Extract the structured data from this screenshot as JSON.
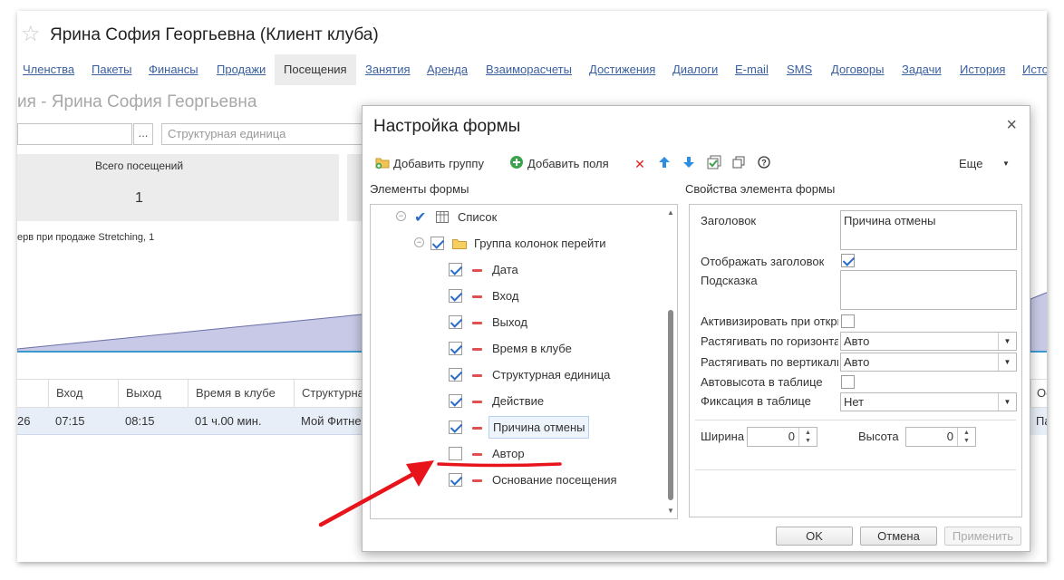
{
  "window": {
    "title": "Ярина София Георгьевна (Клиент клуба)"
  },
  "tabs": [
    {
      "label": "Членства",
      "active": false
    },
    {
      "label": "Пакеты",
      "active": false
    },
    {
      "label": "Финансы",
      "active": false
    },
    {
      "label": "Продажи",
      "active": false
    },
    {
      "label": "Посещения",
      "active": true
    },
    {
      "label": "Занятия",
      "active": false
    },
    {
      "label": "Аренда",
      "active": false
    },
    {
      "label": "Взаиморасчеты",
      "active": false
    },
    {
      "label": "Достижения",
      "active": false
    },
    {
      "label": "Диалоги",
      "active": false
    },
    {
      "label": "E-mail",
      "active": false
    },
    {
      "label": "SMS",
      "active": false
    },
    {
      "label": "Договоры",
      "active": false
    },
    {
      "label": "Задачи",
      "active": false
    },
    {
      "label": "История",
      "active": false
    },
    {
      "label": "Исто",
      "active": false
    }
  ],
  "background": {
    "subtitle": "ия - Ярина София Георгьевна",
    "dots": "...",
    "structure_placeholder": "Структурная единица",
    "stat": {
      "label": "Всего посещений",
      "value": "1"
    },
    "legend_text": "ерв при продаже Stretching, 1",
    "table": {
      "headers": [
        "Вход",
        "Выход",
        "Время в клубе",
        "Структурна"
      ],
      "row": [
        "26",
        "07:15",
        "08:15",
        "01 ч.00 мин.",
        "Мой Фитне"
      ],
      "right_header": "Ос",
      "right_cell": "Па"
    }
  },
  "dialog": {
    "title": "Настройка формы",
    "close": "×",
    "toolbar": {
      "add_group": "Добавить группу",
      "add_fields": "Добавить поля",
      "more": "Еще"
    },
    "left_label": "Элементы формы",
    "right_label": "Свойства элемента формы",
    "tree": [
      {
        "label": "Список",
        "level": 0,
        "checked": true,
        "icon": "table-icon",
        "collapsible": true
      },
      {
        "label": "Группа колонок перейти",
        "level": 1,
        "checked": true,
        "icon": "folder-icon",
        "collapsible": true
      },
      {
        "label": "Дата",
        "level": 2,
        "checked": true,
        "icon": "minus-icon"
      },
      {
        "label": "Вход",
        "level": 2,
        "checked": true,
        "icon": "minus-icon"
      },
      {
        "label": "Выход",
        "level": 2,
        "checked": true,
        "icon": "minus-icon"
      },
      {
        "label": "Время в клубе",
        "level": 2,
        "checked": true,
        "icon": "minus-icon"
      },
      {
        "label": "Структурная единица",
        "level": 2,
        "checked": true,
        "icon": "minus-icon"
      },
      {
        "label": "Действие",
        "level": 2,
        "checked": true,
        "icon": "minus-icon"
      },
      {
        "label": "Причина отмены",
        "level": 2,
        "checked": true,
        "icon": "minus-icon",
        "selected": true
      },
      {
        "label": "Автор",
        "level": 2,
        "checked": false,
        "icon": "minus-icon"
      },
      {
        "label": "Основание посещения",
        "level": 2,
        "checked": true,
        "icon": "minus-icon"
      }
    ],
    "props": {
      "title_label": "Заголовок",
      "title_value": "Причина отмены",
      "show_title_label": "Отображать заголовок",
      "show_title": true,
      "hint_label": "Подсказка",
      "hint_value": "",
      "activate_label": "Активизировать при откры",
      "activate": false,
      "stretch_h_label": "Растягивать по горизонта",
      "stretch_h_value": "Авто",
      "stretch_v_label": "Растягивать по вертикали",
      "stretch_v_value": "Авто",
      "autoheight_label": "Автовысота в таблице",
      "autoheight": false,
      "fixation_label": "Фиксация в таблице",
      "fixation_value": "Нет",
      "width_label": "Ширина",
      "width_value": "0",
      "height_label": "Высота",
      "height_value": "0"
    },
    "buttons": {
      "ok": "OK",
      "cancel": "Отмена",
      "apply": "Применить"
    }
  },
  "colors": {
    "accent": "#2a6cc8",
    "annotation": "#e8141c",
    "link": "#3a5fa0"
  }
}
